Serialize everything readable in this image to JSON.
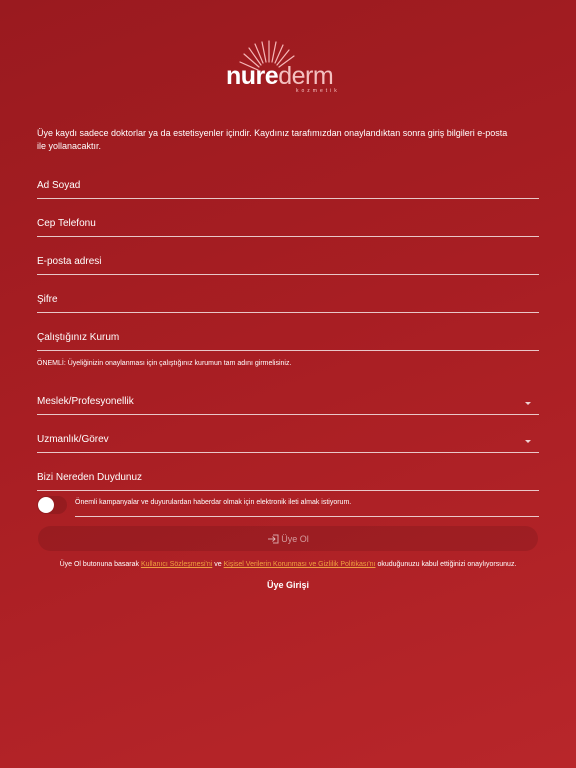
{
  "brand": {
    "logo_bold": "nure",
    "logo_light": "derm",
    "logo_sub": "kozmetik"
  },
  "intro": "Üye kaydı sadece doktorlar ya da estetisyenler içindir. Kaydınız tarafımızdan onaylandıktan sonra giriş bilgileri e-posta ile yollanacaktır.",
  "form": {
    "full_name": "Ad Soyad",
    "phone": "Cep Telefonu",
    "email": "E-posta adresi",
    "password": "Şifre",
    "institution": "Çalıştığınız Kurum",
    "institution_note": "ÖNEMLİ: Üyeliğinizin onaylanması için çalıştığınız kurumun tam adını girmelisiniz.",
    "profession": "Meslek/Profesyonellik",
    "specialty": "Uzmanlık/Görev",
    "referral": "Bizi Nereden Duydunuz",
    "consent_label": "Önemli kampanyalar ve duyurulardan haberdar olmak için elektronik ileti almak istiyorum.",
    "consent_checked": false
  },
  "submit_label": "Üye Ol",
  "legal": {
    "prefix": "Üye Ol butonuna basarak",
    "terms_link": "Kullanıcı Sözleşmesi'ni",
    "connector": "ve",
    "privacy_link": "Kişisel Verilerin Korunması ve Gizlilik Politikası'nı",
    "suffix": "okuduğunuzu kabul ettiğinizi onaylıyorsunuz."
  },
  "login_label": "Üye Girişi",
  "colors": {
    "background": "#a81e23",
    "link": "#f0a040"
  }
}
